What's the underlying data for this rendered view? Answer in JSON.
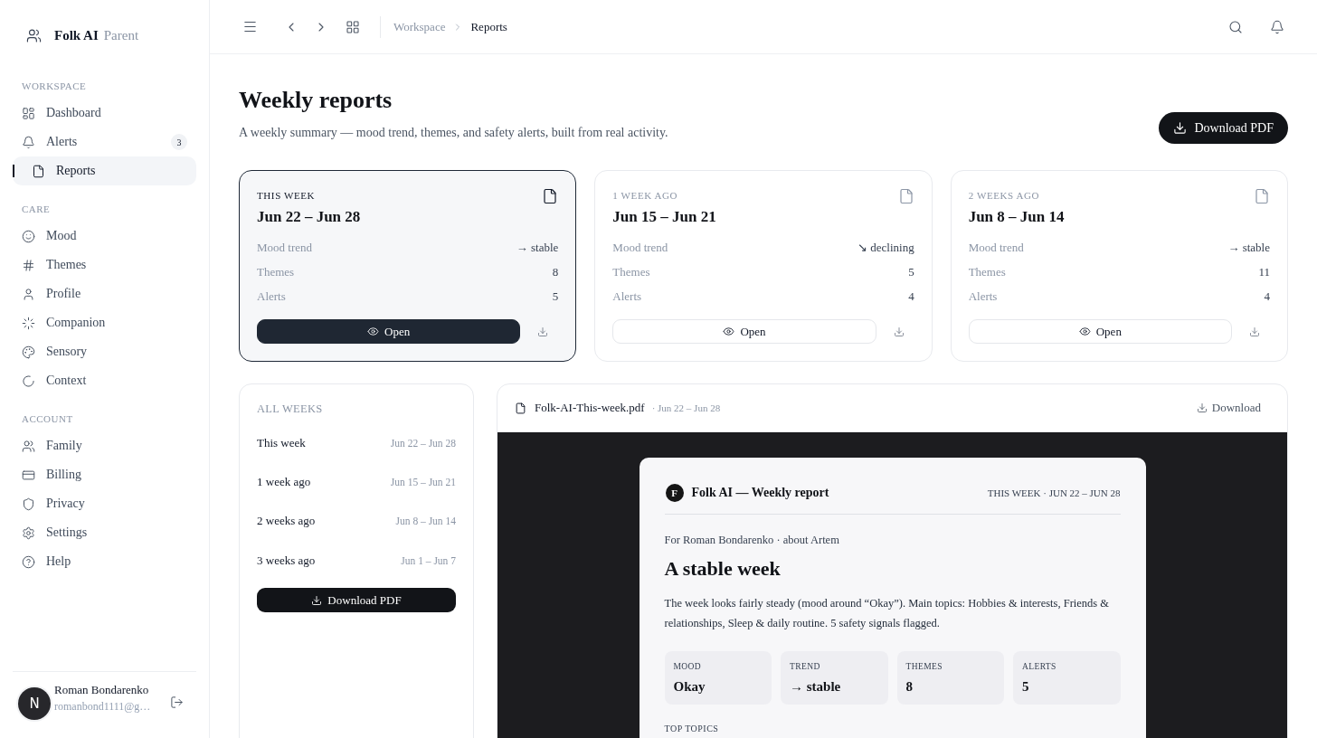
{
  "app": {
    "name": "Folk AI",
    "role": "Parent"
  },
  "sidebar": {
    "sections": [
      {
        "title": "WORKSPACE",
        "items": [
          {
            "label": "Dashboard",
            "selected": false
          },
          {
            "label": "Alerts",
            "selected": false,
            "badge": "3"
          },
          {
            "label": "Reports",
            "selected": true
          }
        ]
      },
      {
        "title": "CARE",
        "items": [
          {
            "label": "Mood",
            "selected": false
          },
          {
            "label": "Themes",
            "selected": false
          },
          {
            "label": "Profile",
            "selected": false
          },
          {
            "label": "Companion",
            "selected": false
          },
          {
            "label": "Sensory",
            "selected": false
          },
          {
            "label": "Context",
            "selected": false
          }
        ]
      },
      {
        "title": "ACCOUNT",
        "items": [
          {
            "label": "Family",
            "selected": false
          },
          {
            "label": "Billing",
            "selected": false
          },
          {
            "label": "Privacy",
            "selected": false
          },
          {
            "label": "Settings",
            "selected": false
          },
          {
            "label": "Help",
            "selected": false
          }
        ]
      }
    ],
    "user": {
      "initial": "N",
      "name": "Roman Bondarenko",
      "email": "romanbond1111@g…"
    }
  },
  "topbar": {
    "breadcrumb": [
      {
        "label": "Workspace",
        "current": false
      },
      {
        "label": "Reports",
        "current": true
      }
    ]
  },
  "page": {
    "title": "Weekly reports",
    "subtitle": "A weekly summary — mood trend, themes, and safety alerts, built from real activity.",
    "action": "Download PDF"
  },
  "week_cards": [
    {
      "label": "THIS WEEK",
      "range": "Jun 22 – Jun 28",
      "selected": true,
      "stats": [
        {
          "label": "Mood trend",
          "value": "→ stable"
        },
        {
          "label": "Themes",
          "value": "8"
        },
        {
          "label": "Alerts",
          "value": "5"
        }
      ],
      "button": "Open"
    },
    {
      "label": "1 WEEK AGO",
      "range": "Jun 15 – Jun 21",
      "selected": false,
      "stats": [
        {
          "label": "Mood trend",
          "value": "↘ declining"
        },
        {
          "label": "Themes",
          "value": "5"
        },
        {
          "label": "Alerts",
          "value": "4"
        }
      ],
      "button": "Open"
    },
    {
      "label": "2 WEEKS AGO",
      "range": "Jun 8 – Jun 14",
      "selected": false,
      "stats": [
        {
          "label": "Mood trend",
          "value": "→ stable"
        },
        {
          "label": "Themes",
          "value": "11"
        },
        {
          "label": "Alerts",
          "value": "4"
        }
      ],
      "button": "Open"
    }
  ],
  "all_weeks": {
    "title": "ALL WEEKS",
    "rows": [
      {
        "label": "This week",
        "range": "Jun 22 – Jun 28"
      },
      {
        "label": "1 week ago",
        "range": "Jun 15 – Jun 21"
      },
      {
        "label": "2 weeks ago",
        "range": "Jun 8 – Jun 14"
      },
      {
        "label": "3 weeks ago",
        "range": "Jun 1 – Jun 7"
      }
    ],
    "button": "Download PDF"
  },
  "preview": {
    "file": "Folk-AI-This-week.pdf",
    "range": "· Jun 22 – Jun 28",
    "download": "Download",
    "document": {
      "logo": "F",
      "title": "Folk AI — Weekly report",
      "period": "THIS WEEK · JUN 22 – JUN 28",
      "recipient": "For Roman Bondarenko · about Artem",
      "headline": "A stable week",
      "summary": "The week looks fairly steady (mood around “Okay”). Main topics: Hobbies & interests, Friends & relationships, Sleep & daily routine. 5 safety signals flagged.",
      "tiles": [
        {
          "label": "MOOD",
          "value": "Okay"
        },
        {
          "label": "TREND",
          "value": "→ stable"
        },
        {
          "label": "THEMES",
          "value": "8"
        },
        {
          "label": "ALERTS",
          "value": "5"
        }
      ],
      "section": "TOP TOPICS"
    }
  }
}
